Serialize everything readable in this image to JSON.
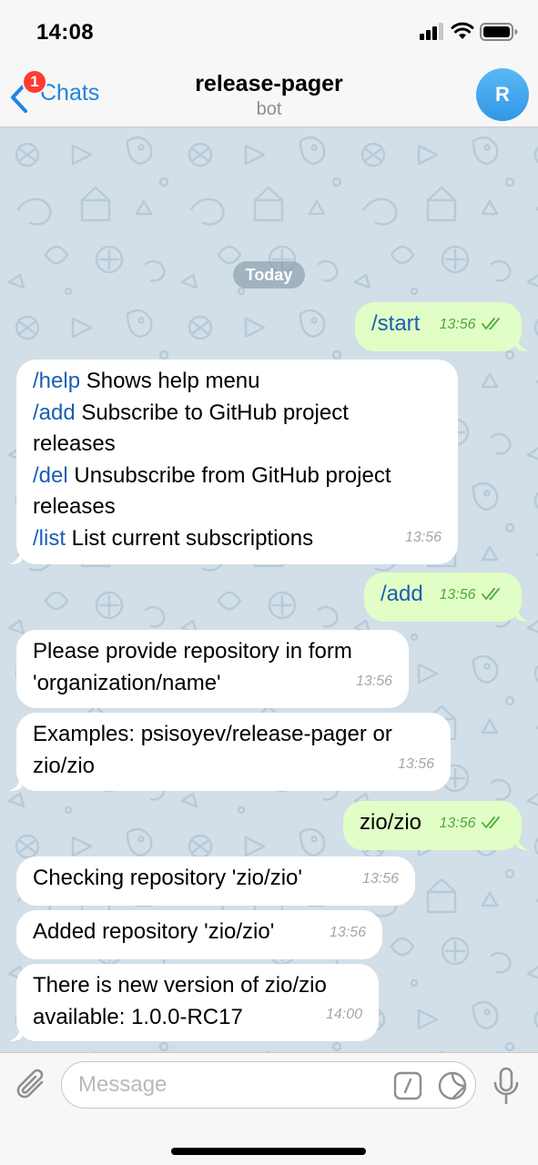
{
  "status_bar": {
    "time": "14:08"
  },
  "nav": {
    "back_label": "Chats",
    "unread_count": "1",
    "title": "release-pager",
    "subtitle": "bot",
    "avatar_letter": "R"
  },
  "chat": {
    "date_separator": "Today",
    "messages": [
      {
        "direction": "out",
        "text": "/start",
        "time": "13:56"
      },
      {
        "direction": "in",
        "lines": [
          {
            "cmd": "/help",
            "rest": " Shows help menu"
          },
          {
            "cmd": "/add",
            "rest": " Subscribe to GitHub project"
          },
          {
            "cmd": "",
            "rest": "releases"
          },
          {
            "cmd": "/del",
            "rest": " Unsubscribe from GitHub project"
          },
          {
            "cmd": "",
            "rest": "releases"
          },
          {
            "cmd": "/list",
            "rest": " List current subscriptions"
          }
        ],
        "time": "13:56"
      },
      {
        "direction": "out",
        "text": "/add",
        "time": "13:56"
      },
      {
        "direction": "in",
        "lines": [
          "Please provide repository in form",
          "'organization/name'"
        ],
        "time": "13:56"
      },
      {
        "direction": "in",
        "lines": [
          "Examples: psisoyev/release-pager or",
          "zio/zio"
        ],
        "time": "13:56"
      },
      {
        "direction": "out",
        "text": "zio/zio",
        "time": "13:56"
      },
      {
        "direction": "in",
        "lines": [
          "Checking repository 'zio/zio'"
        ],
        "time": "13:56"
      },
      {
        "direction": "in",
        "lines": [
          "Added repository 'zio/zio'"
        ],
        "time": "13:56"
      },
      {
        "direction": "in",
        "lines": [
          "There is new version of zio/zio",
          "available: 1.0.0-RC17"
        ],
        "time": "14:00"
      }
    ]
  },
  "input": {
    "placeholder": "Message",
    "value": ""
  },
  "colors": {
    "accent": "#1f84de",
    "outgoing_bubble": "#e1fec6",
    "incoming_bubble": "#ffffff",
    "chat_background": "#d2dfe8",
    "badge": "#ff3b30",
    "read_check": "#4cab3b"
  },
  "icons": {
    "back": "chevron-left-icon",
    "attach": "paperclip-icon",
    "commands": "slash-command-icon",
    "sticker": "sticker-icon",
    "voice": "microphone-icon",
    "read": "double-check-icon"
  }
}
